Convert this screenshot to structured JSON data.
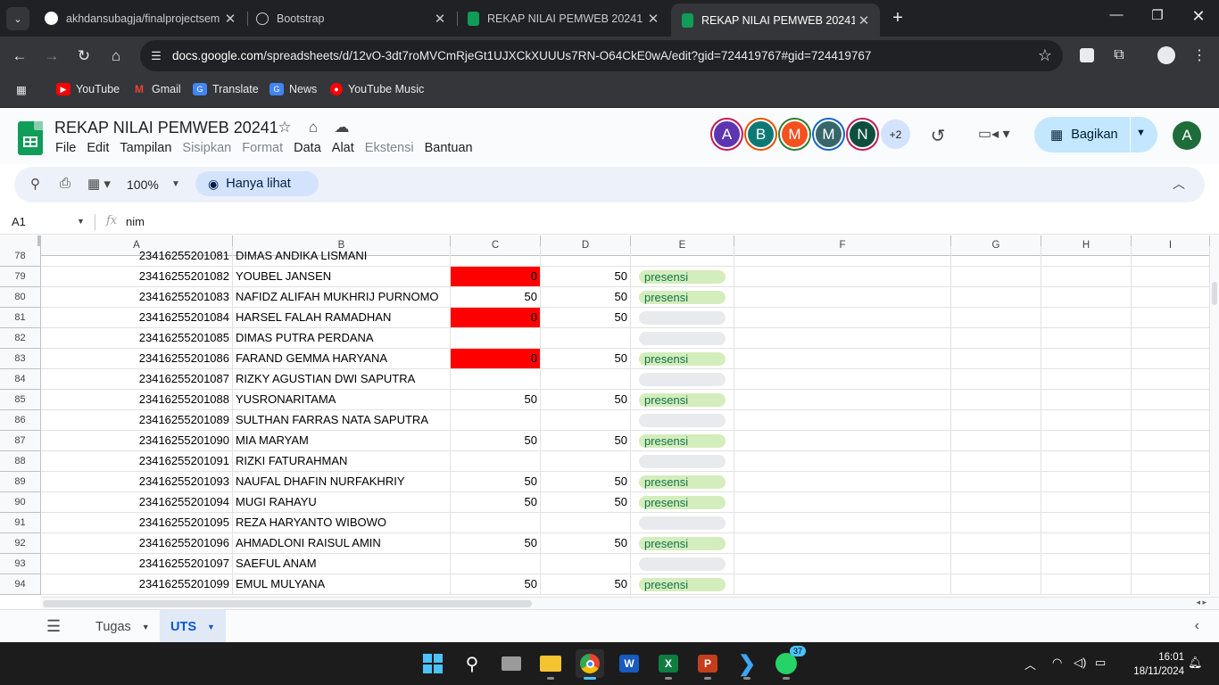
{
  "browser": {
    "tabs": [
      {
        "title": "akhdansubagja/finalprojectsem",
        "close": "✕"
      },
      {
        "title": "Bootstrap",
        "close": "✕"
      },
      {
        "title": "REKAP NILAI PEMWEB 20241 - ",
        "close": "✕"
      },
      {
        "title": "REKAP NILAI PEMWEB 20241 - ",
        "close": "✕"
      }
    ],
    "url_host": "docs.google.com",
    "url_path": "/spreadsheets/d/12vO-3dt7roMVCmRjeGt1UJXCkXUUUs7RN-O64CkE0wA/edit?gid=724419767#gid=724419767",
    "bookmarks": [
      "YouTube",
      "Gmail",
      "Translate",
      "News",
      "YouTube Music"
    ]
  },
  "sheets": {
    "title": "REKAP NILAI PEMWEB 20241",
    "menu": [
      {
        "label": "File",
        "disabled": false
      },
      {
        "label": "Edit",
        "disabled": false
      },
      {
        "label": "Tampilan",
        "disabled": false
      },
      {
        "label": "Sisipkan",
        "disabled": true
      },
      {
        "label": "Format",
        "disabled": true
      },
      {
        "label": "Data",
        "disabled": false
      },
      {
        "label": "Alat",
        "disabled": false
      },
      {
        "label": "Ekstensi",
        "disabled": true
      },
      {
        "label": "Bantuan",
        "disabled": false
      }
    ],
    "collaborators": [
      {
        "initial": "A",
        "color": "#5e35b1",
        "ring": "#c2185b"
      },
      {
        "initial": "B",
        "color": "#0b7a75",
        "ring": "#e65100"
      },
      {
        "initial": "M",
        "color": "#f4511e",
        "ring": "#2e7d32"
      },
      {
        "initial": "M",
        "color": "#37676b",
        "ring": "#1565c0"
      },
      {
        "initial": "N",
        "color": "#0d4f3c",
        "ring": "#c2185b"
      }
    ],
    "more_collaborators": "+2",
    "share_label": "Bagikan",
    "user_initial": "A",
    "zoom": "100%",
    "view_only_label": "Hanya lihat",
    "name_box": "A1",
    "fx_symbol": "fx",
    "formula_value": "nim",
    "columns": [
      "A",
      "B",
      "C",
      "D",
      "E",
      "F",
      "G",
      "H",
      "I"
    ],
    "partial_row": {
      "row": "78",
      "a": "23416255201081",
      "b": "DIMAS ANDIKA LISMANI"
    },
    "rows": [
      {
        "row": "79",
        "a": "23416255201082",
        "b": "YOUBEL JANSEN",
        "c": "0",
        "c_red": true,
        "d": "50",
        "e": "presensi"
      },
      {
        "row": "80",
        "a": "23416255201083",
        "b": "NAFIDZ ALIFAH MUKHRIJ PURNOMO",
        "c": "50",
        "c_red": false,
        "d": "50",
        "e": "presensi"
      },
      {
        "row": "81",
        "a": "23416255201084",
        "b": "HARSEL FALAH RAMADHAN",
        "c": "0",
        "c_red": true,
        "d": "50",
        "e": ""
      },
      {
        "row": "82",
        "a": "23416255201085",
        "b": "DIMAS PUTRA PERDANA",
        "c": "",
        "c_red": false,
        "d": "",
        "e": ""
      },
      {
        "row": "83",
        "a": "23416255201086",
        "b": "FARAND GEMMA HARYANA",
        "c": "0",
        "c_red": true,
        "d": "50",
        "e": "presensi"
      },
      {
        "row": "84",
        "a": "23416255201087",
        "b": "RIZKY AGUSTIAN DWI SAPUTRA",
        "c": "",
        "c_red": false,
        "d": "",
        "e": ""
      },
      {
        "row": "85",
        "a": "23416255201088",
        "b": "YUSRONARITAMA",
        "c": "50",
        "c_red": false,
        "d": "50",
        "e": "presensi"
      },
      {
        "row": "86",
        "a": "23416255201089",
        "b": "SULTHAN FARRAS NATA SAPUTRA",
        "c": "",
        "c_red": false,
        "d": "",
        "e": ""
      },
      {
        "row": "87",
        "a": "23416255201090",
        "b": "MIA MARYAM",
        "c": "50",
        "c_red": false,
        "d": "50",
        "e": "presensi"
      },
      {
        "row": "88",
        "a": "23416255201091",
        "b": "RIZKI FATURAHMAN",
        "c": "",
        "c_red": false,
        "d": "",
        "e": ""
      },
      {
        "row": "89",
        "a": "23416255201093",
        "b": "NAUFAL DHAFIN NURFAKHRIY",
        "c": "50",
        "c_red": false,
        "d": "50",
        "e": "presensi"
      },
      {
        "row": "90",
        "a": "23416255201094",
        "b": "MUGI RAHAYU",
        "c": "50",
        "c_red": false,
        "d": "50",
        "e": "presensi"
      },
      {
        "row": "91",
        "a": "23416255201095",
        "b": "REZA HARYANTO WIBOWO",
        "c": "",
        "c_red": false,
        "d": "",
        "e": ""
      },
      {
        "row": "92",
        "a": "23416255201096",
        "b": "AHMADLONI RAISUL AMIN",
        "c": "50",
        "c_red": false,
        "d": "50",
        "e": "presensi"
      },
      {
        "row": "93",
        "a": "23416255201097",
        "b": "SAEFUL ANAM",
        "c": "",
        "c_red": false,
        "d": "",
        "e": ""
      },
      {
        "row": "94",
        "a": "23416255201099",
        "b": "EMUL MULYANA",
        "c": "50",
        "c_red": false,
        "d": "50",
        "e": "presensi"
      }
    ],
    "sheet_tabs": [
      {
        "label": "Tugas",
        "active": false
      },
      {
        "label": "UTS",
        "active": true
      }
    ]
  },
  "taskbar": {
    "whatsapp_badge": "37",
    "time": "16:01",
    "date": "18/11/2024"
  }
}
